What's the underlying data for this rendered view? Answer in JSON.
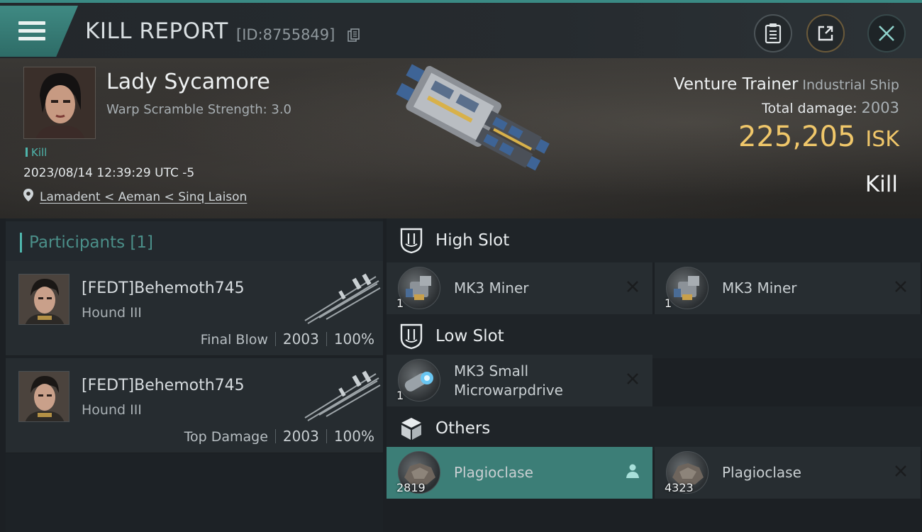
{
  "header": {
    "title": "KILL REPORT",
    "report_id": "[ID:8755849]"
  },
  "victim": {
    "name": "Lady Sycamore",
    "warp_scramble": "Warp Scramble Strength: 3.0",
    "kill_tag": "Kill",
    "datetime": "2023/08/14 12:39:29 UTC -5",
    "location": "Lamadent < Aeman < Sinq Laison"
  },
  "ship": {
    "name": "Venture Trainer",
    "class": "Industrial Ship",
    "total_damage_label": "Total damage:",
    "total_damage_value": "2003",
    "isk_value": "225,205",
    "isk_unit": "ISK",
    "result": "Kill"
  },
  "participants": {
    "header": "Participants [1]",
    "items": [
      {
        "name": "[FEDT]Behemoth745",
        "ship": "Hound III",
        "label": "Final Blow",
        "damage": "2003",
        "percent": "100%"
      },
      {
        "name": "[FEDT]Behemoth745",
        "ship": "Hound III",
        "label": "Top Damage",
        "damage": "2003",
        "percent": "100%"
      }
    ]
  },
  "slots": {
    "high": {
      "title": "High Slot",
      "items": [
        {
          "name": "MK3 Miner",
          "qty": "1"
        },
        {
          "name": "MK3 Miner",
          "qty": "1"
        }
      ]
    },
    "low": {
      "title": "Low Slot",
      "items": [
        {
          "name_line1": "MK3 Small",
          "name_line2": "Microwarpdrive",
          "qty": "1"
        }
      ]
    },
    "others": {
      "title": "Others",
      "items": [
        {
          "name": "Plagioclase",
          "qty": "2819",
          "selected": true
        },
        {
          "name": "Plagioclase",
          "qty": "4323",
          "selected": false
        }
      ]
    }
  },
  "colors": {
    "accent": "#4fb5ac",
    "isk": "#f0c76a",
    "selected_row": "#3c7e77"
  }
}
